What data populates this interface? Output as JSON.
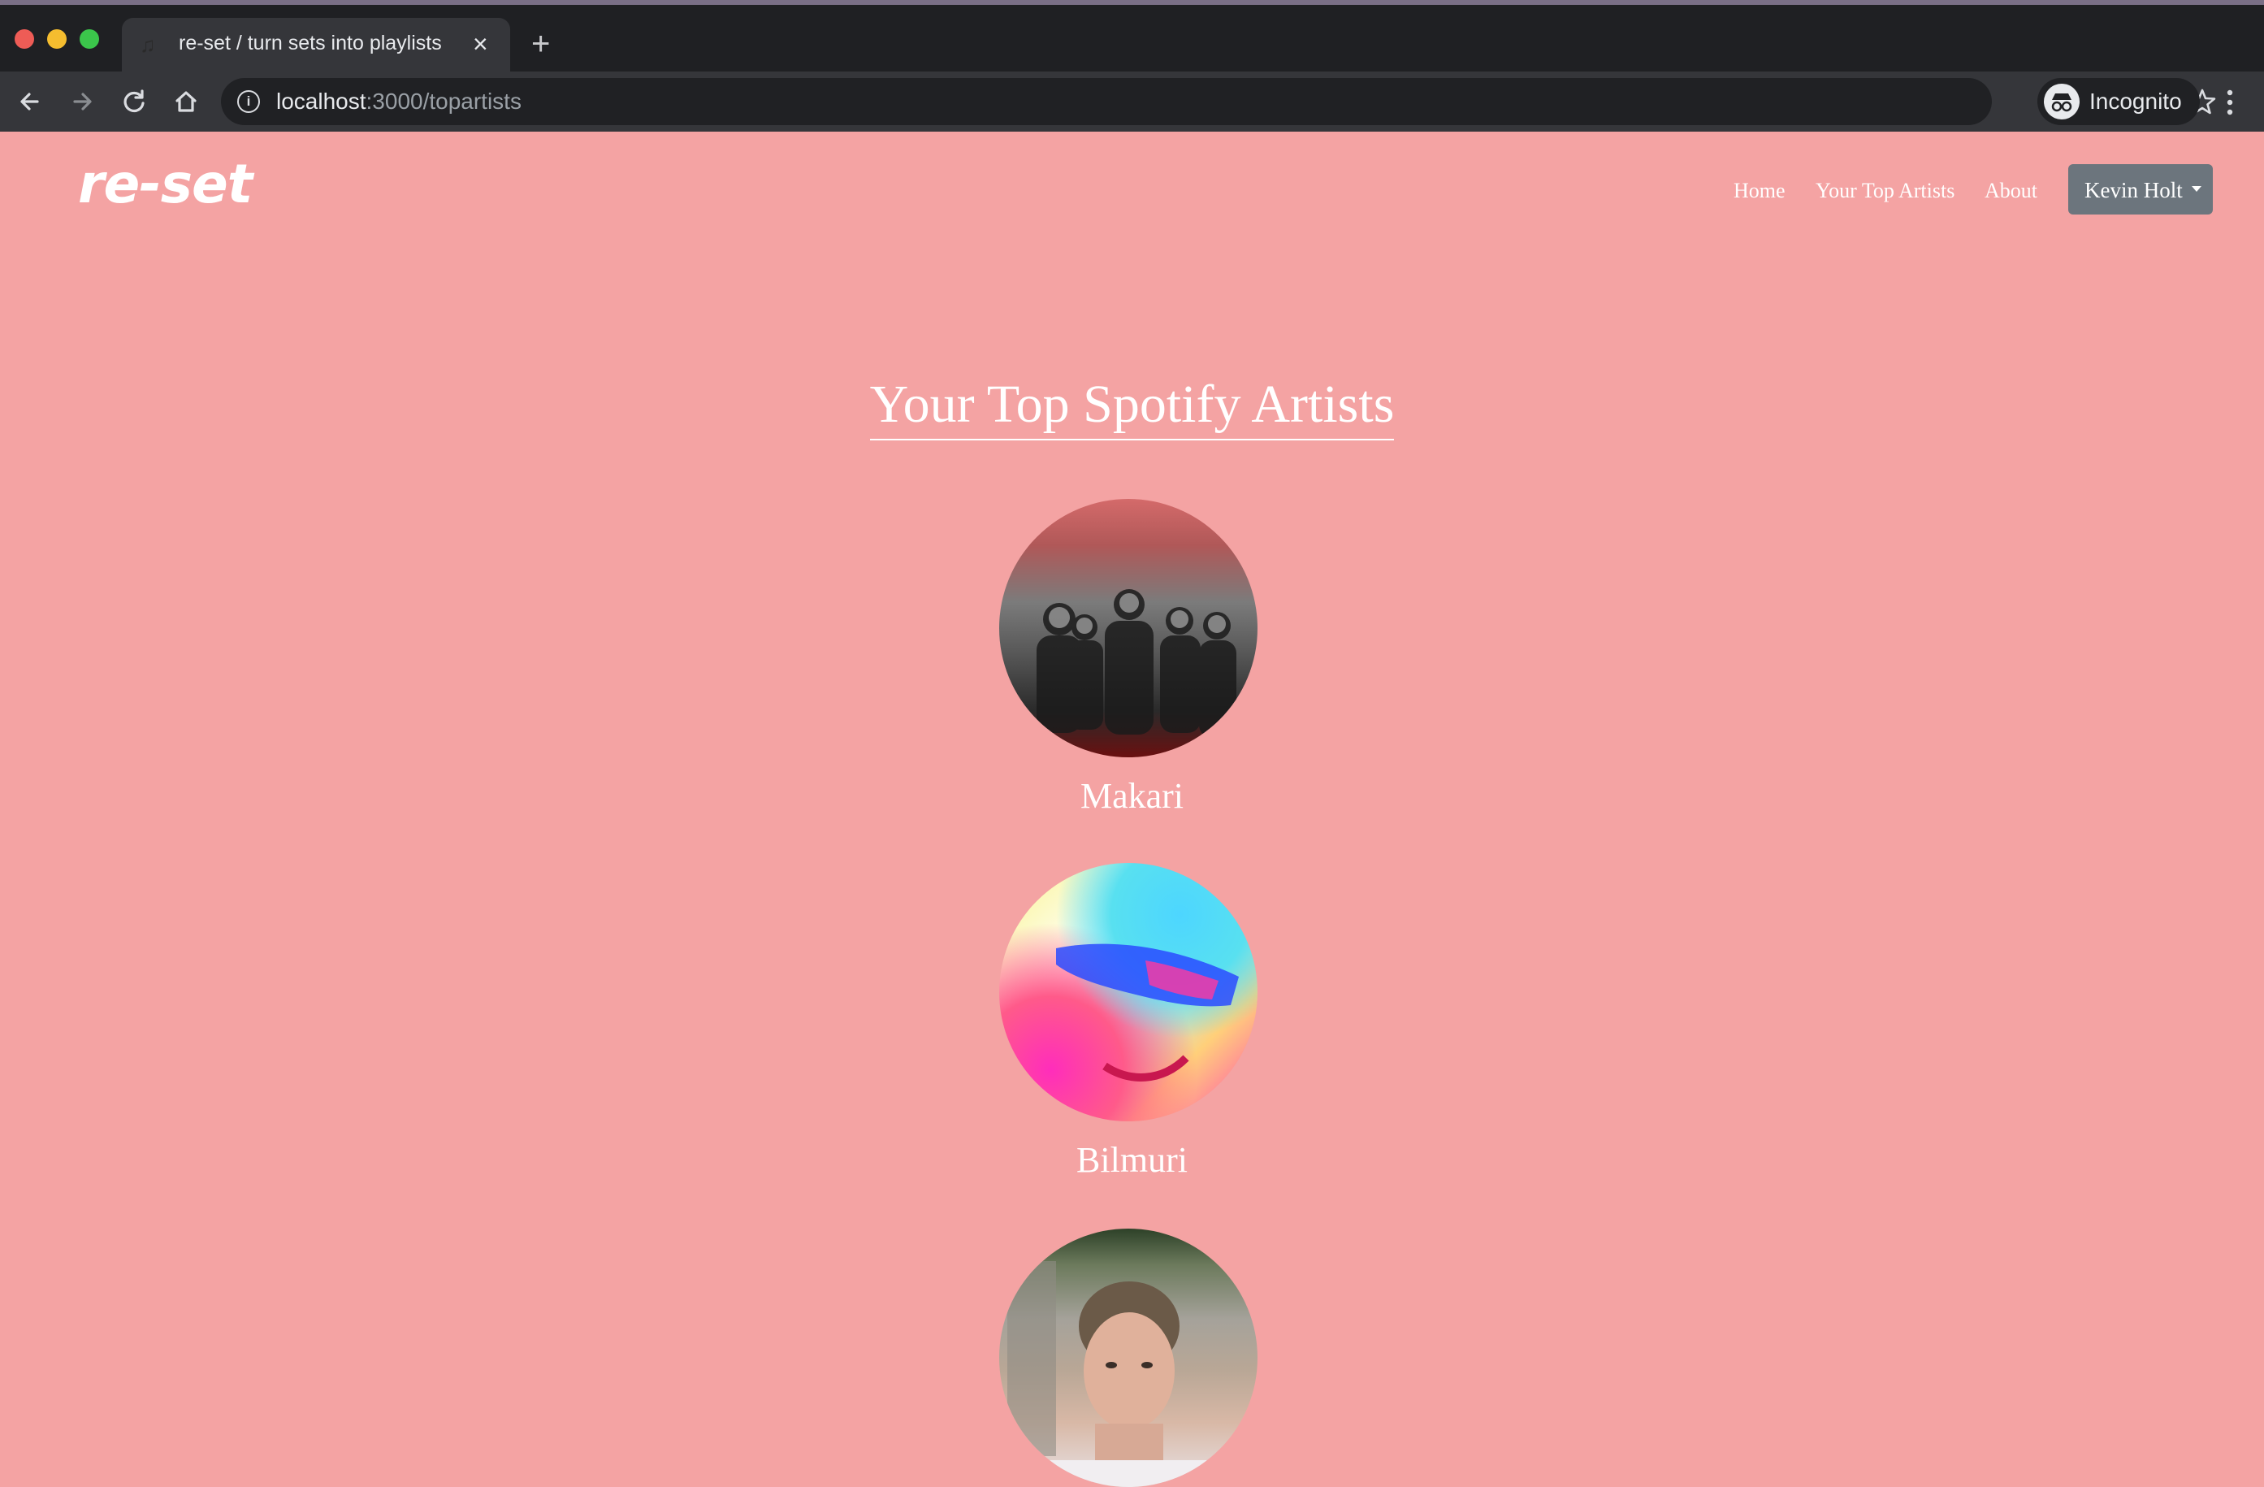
{
  "browser": {
    "tab_title": "re-set / turn sets into playlists",
    "tab_favicon": "music-note-icon",
    "url_host": "localhost",
    "url_path": ":3000/topartists",
    "profile_label": "Incognito"
  },
  "navbar": {
    "brand": "re-set",
    "links": [
      "Home",
      "Your Top Artists",
      "About"
    ],
    "user_button": "Kevin Holt"
  },
  "main": {
    "heading": "Your Top Spotify Artists",
    "artists": [
      {
        "name": "Makari"
      },
      {
        "name": "Bilmuri"
      },
      {
        "name": ""
      }
    ]
  },
  "colors": {
    "page_background": "#f4a3a3",
    "user_button_bg": "#6c757d",
    "chrome_dark": "#1f2023",
    "toolbar": "#35363a"
  }
}
